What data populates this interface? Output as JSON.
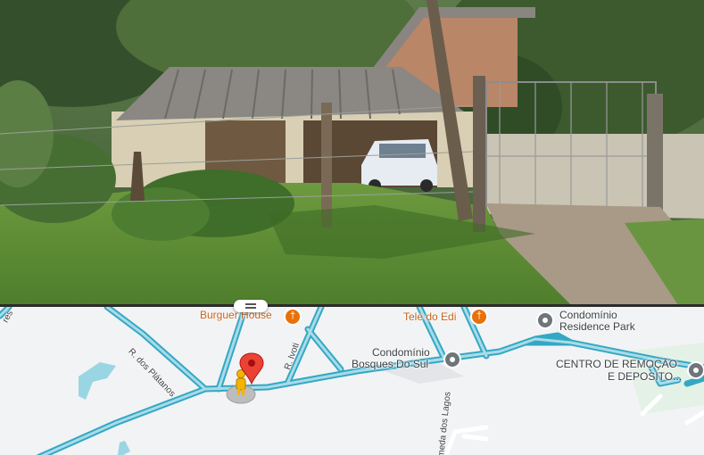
{
  "map": {
    "pois": [
      {
        "name": "Burguer House",
        "category": "restaurant"
      },
      {
        "name": "Tele do Edi",
        "category": "restaurant"
      },
      {
        "name": "Condomínio Residence Park",
        "line1": "Condomínio",
        "line2": "Residence Park",
        "category": "place"
      },
      {
        "name": "Condomínio Bosques Do Sul",
        "line1": "Condomínio",
        "line2": "Bosques Do Sul",
        "category": "place"
      },
      {
        "name": "CENTRO DE REMOÇÃO E DEPOSITO...",
        "line1": "CENTRO DE REMOÇÃO",
        "line2": "E DEPOSITO...",
        "category": "place"
      }
    ],
    "streets": [
      "R. dos Plátanos",
      "R. Ivoti",
      "Alameda dos Lagos",
      "R."
    ],
    "street_labels_visible": [
      "R. dos Plátanos",
      "R. Ivoti",
      "meda dos Lagos",
      "res"
    ],
    "colors": {
      "road_casing": "#33a8c4",
      "road_fill": "#a9dbe8",
      "water": "#9ad5e4",
      "pin": "#ea4335",
      "pegman": "#f5b400",
      "food_icon": "#e8710a",
      "place_icon": "#70757a"
    },
    "icons": [
      "location-pin-icon",
      "pegman-icon",
      "restaurant-icon",
      "place-marker-icon"
    ]
  }
}
